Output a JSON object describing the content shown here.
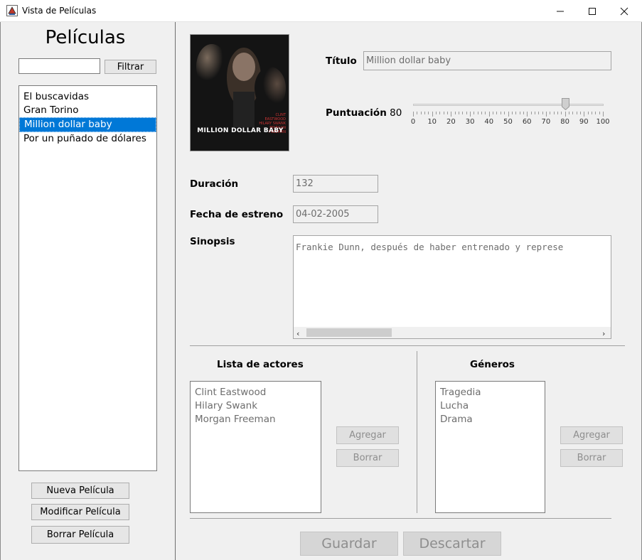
{
  "window": {
    "title": "Vista de Películas"
  },
  "left": {
    "heading": "Películas",
    "filter_value": "",
    "filter_button": "Filtrar",
    "movies": [
      "El buscavidas",
      "Gran Torino",
      "Million dollar baby",
      "Por un puñado de dólares"
    ],
    "selected_index": 2,
    "buttons": {
      "new": "Nueva Película",
      "edit": "Modificar Película",
      "delete": "Borrar Película"
    }
  },
  "poster": {
    "credits": [
      "CLINT EASTWOOD",
      "HILARY SWANK",
      "MORGAN FREEMAN"
    ],
    "title": "MILLION DOLLAR BABY"
  },
  "details": {
    "title_label": "Título",
    "title_value": "Million dollar baby",
    "rating_label": "Puntuación",
    "rating_value": "80",
    "rating": {
      "value": 80,
      "min": 0,
      "max": 100
    },
    "scale_labels": [
      "0",
      "10",
      "20",
      "30",
      "40",
      "50",
      "60",
      "70",
      "80",
      "90",
      "100"
    ],
    "duration_label": "Duración",
    "duration_value": "132",
    "release_label": "Fecha de estreno",
    "release_value": "04-02-2005",
    "synopsis_label": "Sinopsis",
    "synopsis_value": "Frankie Dunn, después de haber entrenado y represe"
  },
  "actors": {
    "heading": "Lista de actores",
    "items": [
      "Clint Eastwood",
      "Hilary Swank",
      "Morgan Freeman"
    ],
    "add": "Agregar",
    "delete": "Borrar"
  },
  "genres": {
    "heading": "Géneros",
    "items": [
      "Tragedia",
      "Lucha",
      "Drama"
    ],
    "add": "Agregar",
    "delete": "Borrar"
  },
  "footer": {
    "save": "Guardar",
    "discard": "Descartar"
  }
}
